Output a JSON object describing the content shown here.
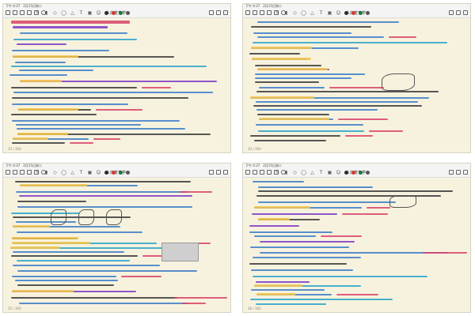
{
  "window_title": "人体发育学",
  "status_bar": {
    "time": "下午 4:37",
    "date": "2月15日周二",
    "battery": "66%"
  },
  "toolbar": {
    "icons": [
      "grid-icon",
      "close-icon",
      "back-icon",
      "redo-icon",
      "share-icon",
      "search-icon"
    ],
    "tools": [
      "pen-icon",
      "highlighter-icon",
      "eraser-icon",
      "lasso-icon",
      "shape-icon",
      "text-icon",
      "image-icon",
      "sticker-icon"
    ],
    "colors": [
      "#2b2b2b",
      "#d23b30",
      "#1b7a3a",
      "#555555"
    ],
    "right_icons": [
      "add-page-icon",
      "pages-icon",
      "more-icon"
    ]
  },
  "panels": [
    {
      "page": "33 / 300"
    },
    {
      "page": "34 / 300"
    },
    {
      "page": "35 / 300"
    },
    {
      "page": "36 / 300"
    }
  ],
  "ink_colors": {
    "title": "#d9436a",
    "heading": "#7b39c4",
    "body": "#3b7cc9",
    "accent": "#2aa3c9",
    "note": "#3a3a3a",
    "highlight": "#f6c64a"
  }
}
